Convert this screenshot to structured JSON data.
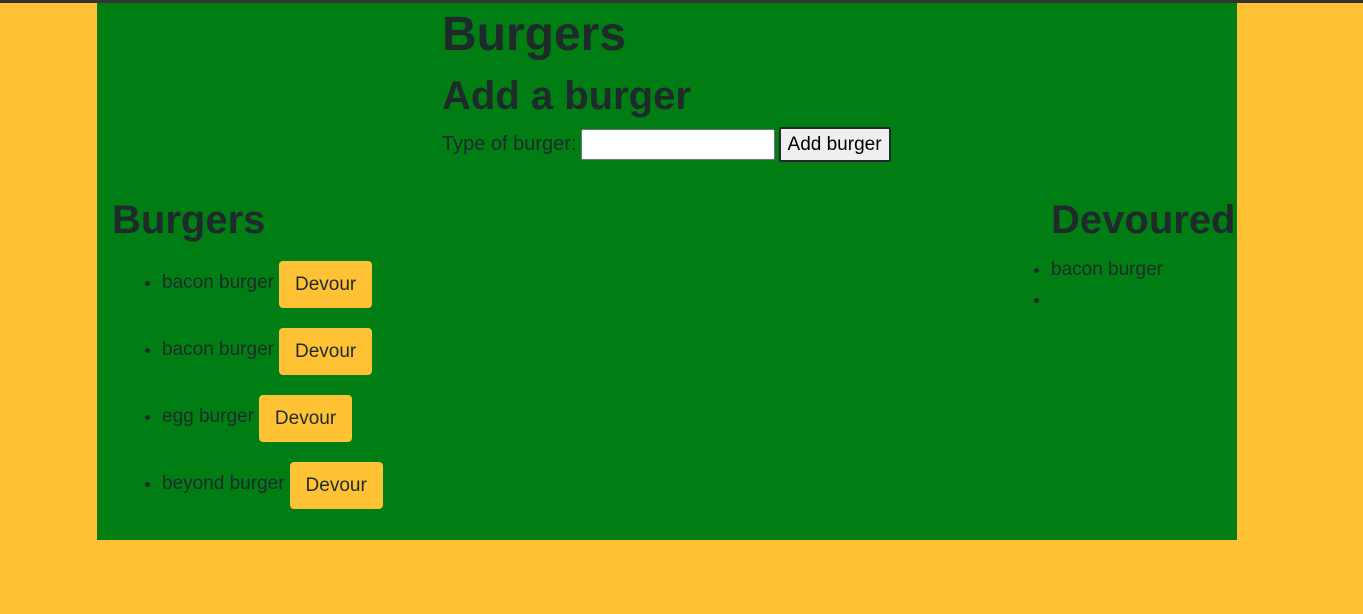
{
  "header": {
    "title": "Burgers",
    "add_title": "Add a burger",
    "form_label": "Type of burger:",
    "input_value": "",
    "add_button": "Add burger"
  },
  "burgers_section": {
    "title": "Burgers",
    "items": [
      {
        "name": "bacon burger",
        "button": "Devour"
      },
      {
        "name": "bacon burger",
        "button": "Devour"
      },
      {
        "name": "egg burger",
        "button": "Devour"
      },
      {
        "name": "beyond burger",
        "button": "Devour"
      }
    ]
  },
  "devoured_section": {
    "title": "Devoured",
    "items": [
      "bacon burger",
      ""
    ]
  },
  "colors": {
    "page_background": "#ffc234",
    "container_background": "#007e14",
    "button_background": "#ffc234",
    "text": "#1f2a2a"
  }
}
